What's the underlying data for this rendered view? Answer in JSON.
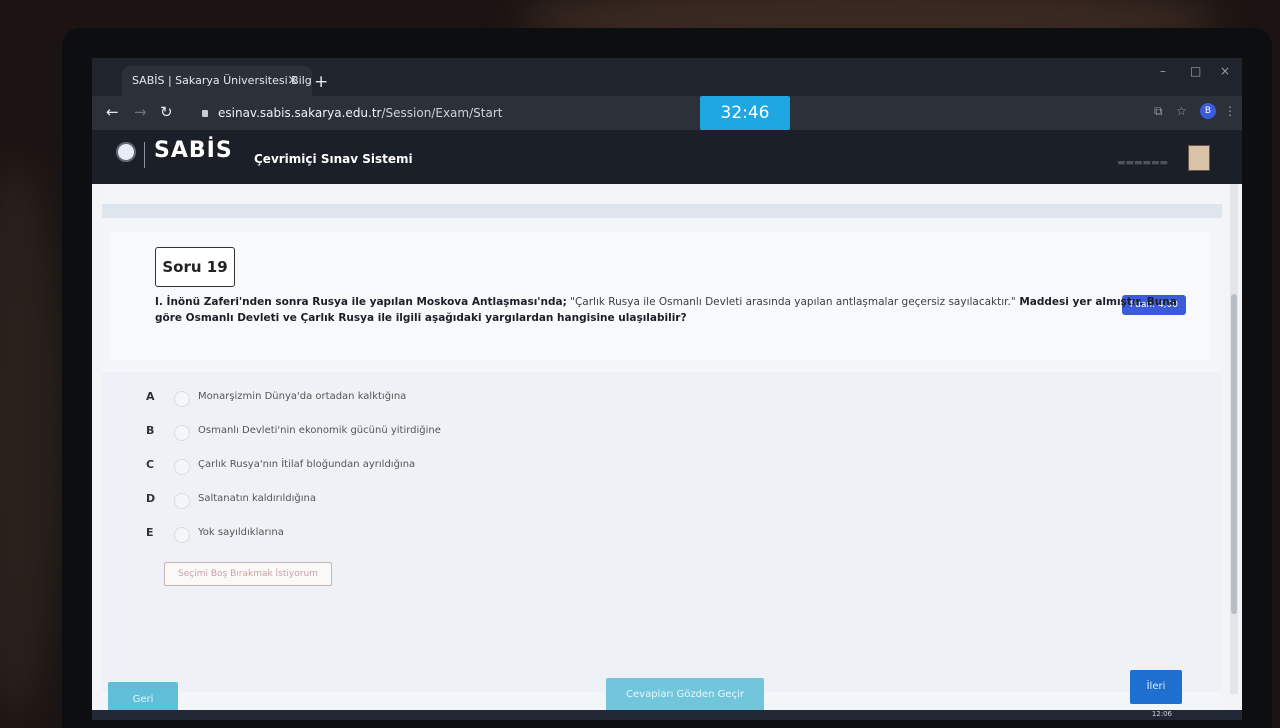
{
  "browser": {
    "tab_title": "SABİS | Sakarya Üniversitesi Bilg",
    "tab_close": "×",
    "new_tab": "+",
    "nav_back": "←",
    "nav_forward": "→",
    "nav_reload": "↻",
    "url_host": "esinav.sabis.sakarya.edu.tr",
    "url_path": "/Session/Exam/Start",
    "profile_initial": "B",
    "min": "–",
    "max": "□",
    "close": "×"
  },
  "header": {
    "logo_text": "SABİS",
    "app_title": "Çevrimiçi Sınav Sistemi",
    "timer": "32:46"
  },
  "question": {
    "number_label": "Soru 19",
    "points": "Puan: 4,00",
    "text_bold_1": "I. İnönü Zaferi'nden sonra Rusya ile yapılan Moskova Antlaşması'nda;",
    "text_quote": " \"Çarlık Rusya ile Osmanlı Devleti arasında yapılan antlaşmalar geçersiz sayılacaktır.\"",
    "text_bold_2": " Maddesi yer almıştır. Buna göre Osmanlı Devleti ve Çarlık Rusya ile ilgili aşağıdaki yargılardan hangisine ulaşılabilir?"
  },
  "options": [
    {
      "letter": "A",
      "text": "Monarşizmin Dünya'da ortadan kalktığına"
    },
    {
      "letter": "B",
      "text": "Osmanlı Devleti'nin ekonomik gücünü yitirdiğine"
    },
    {
      "letter": "C",
      "text": "Çarlık Rusya'nın İtilaf bloğundan ayrıldığına"
    },
    {
      "letter": "D",
      "text": "Saltanatın kaldırıldığına"
    },
    {
      "letter": "E",
      "text": "Yok sayıldıklarına"
    }
  ],
  "buttons": {
    "skip": "Seçimi Boş Bırakmak İstiyorum",
    "back": "Geri",
    "review": "Cevapları Gözden Geçir",
    "next": "İleri"
  },
  "taskbar": {
    "clock": "12:06"
  },
  "colors": {
    "timer": "#1ea7e1",
    "points_badge": "#3d5bd9",
    "next": "#1f6fd0"
  }
}
